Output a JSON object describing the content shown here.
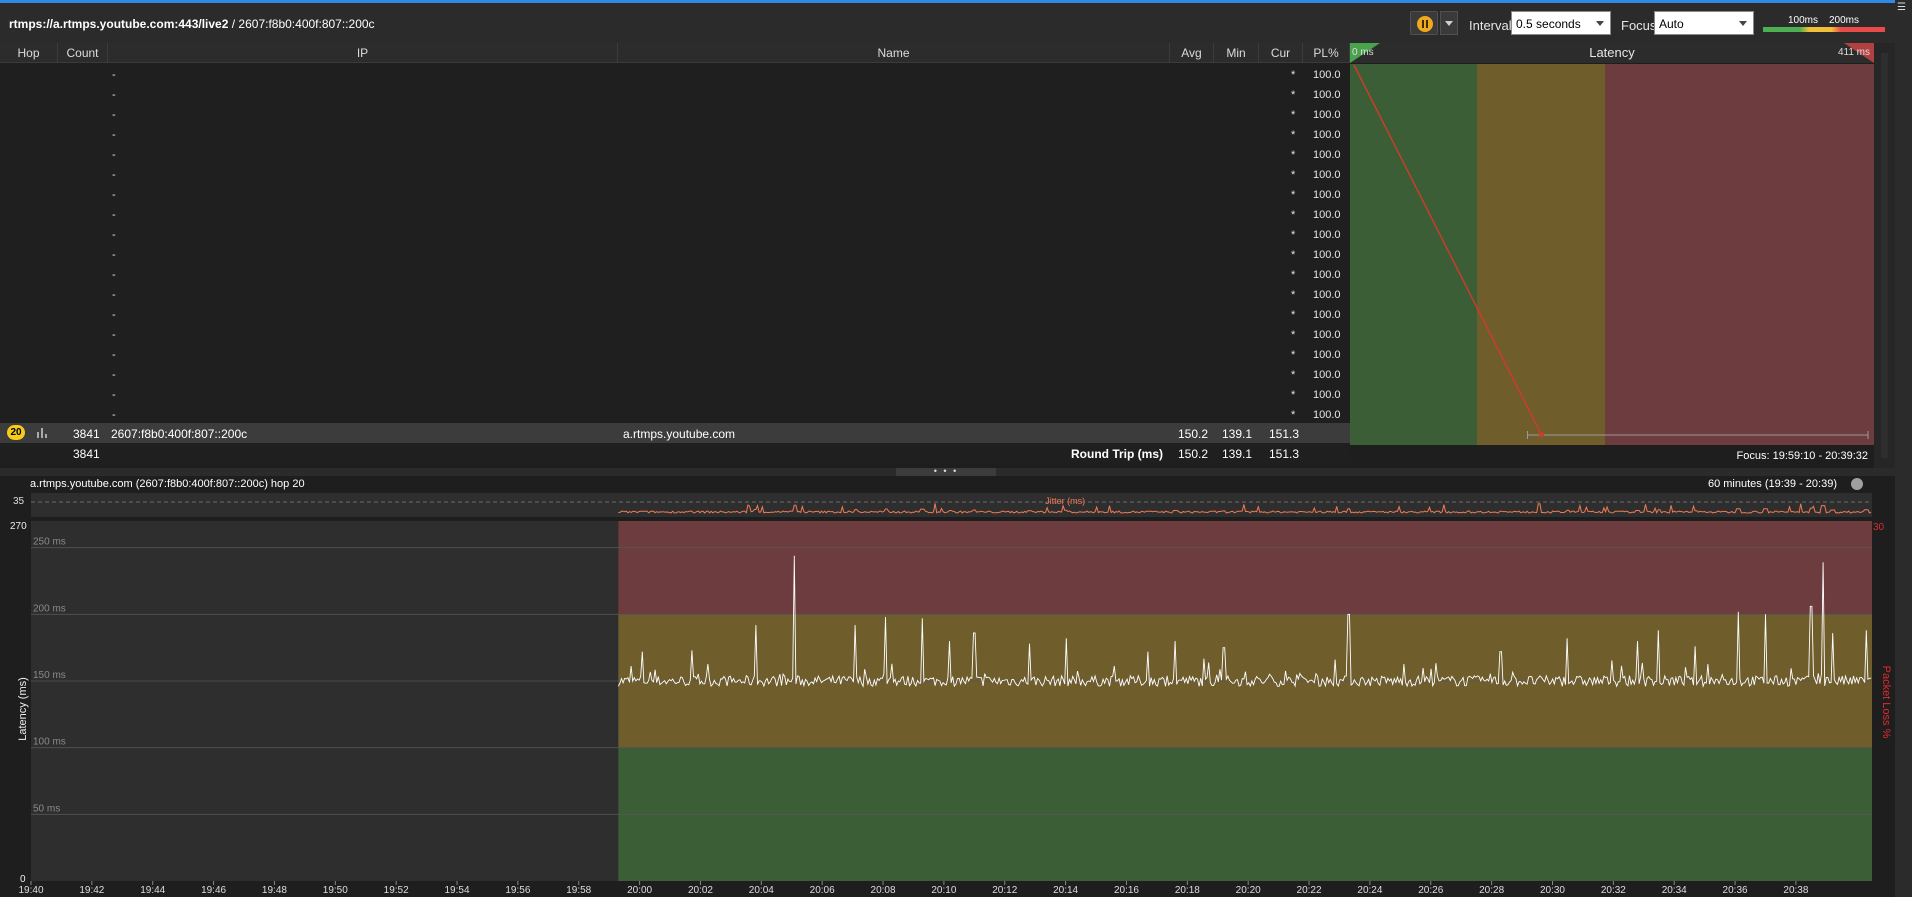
{
  "colors": {
    "accent": "#2f8ae5",
    "good": "#3b5e37",
    "warn": "#6f5d2c",
    "bad": "#6d3c3f",
    "trace": "#ffffff",
    "jitter": "#f07a55"
  },
  "toolbar": {
    "target_host": "rtmps://a.rtmps.youtube.com:443/live2",
    "target_sep": " / ",
    "target_ip": "2607:f8b0:400f:807::200c",
    "pause_icon": "pause-icon",
    "interval_label": "Interval",
    "interval_value": "0.5 seconds",
    "focus_label": "Focus",
    "focus_value": "Auto",
    "scale_low": "100ms",
    "scale_high": "200ms"
  },
  "table": {
    "columns": [
      "Hop",
      "Count",
      "IP",
      "Name",
      "Avg",
      "Min",
      "Cur",
      "PL%"
    ],
    "timeout_rows": [
      {
        "ip": "-",
        "cur": "*",
        "pl": "100.0"
      },
      {
        "ip": "-",
        "cur": "*",
        "pl": "100.0"
      },
      {
        "ip": "-",
        "cur": "*",
        "pl": "100.0"
      },
      {
        "ip": "-",
        "cur": "*",
        "pl": "100.0"
      },
      {
        "ip": "-",
        "cur": "*",
        "pl": "100.0"
      },
      {
        "ip": "-",
        "cur": "*",
        "pl": "100.0"
      },
      {
        "ip": "-",
        "cur": "*",
        "pl": "100.0"
      },
      {
        "ip": "-",
        "cur": "*",
        "pl": "100.0"
      },
      {
        "ip": "-",
        "cur": "*",
        "pl": "100.0"
      },
      {
        "ip": "-",
        "cur": "*",
        "pl": "100.0"
      },
      {
        "ip": "-",
        "cur": "*",
        "pl": "100.0"
      },
      {
        "ip": "-",
        "cur": "*",
        "pl": "100.0"
      },
      {
        "ip": "-",
        "cur": "*",
        "pl": "100.0"
      },
      {
        "ip": "-",
        "cur": "*",
        "pl": "100.0"
      },
      {
        "ip": "-",
        "cur": "*",
        "pl": "100.0"
      },
      {
        "ip": "-",
        "cur": "*",
        "pl": "100.0"
      },
      {
        "ip": "-",
        "cur": "*",
        "pl": "100.0"
      },
      {
        "ip": "-",
        "cur": "*",
        "pl": "100.0"
      }
    ],
    "final_row": {
      "hop": "20",
      "count": "3841",
      "ip": "2607:f8b0:400f:807::200c",
      "name": "a.rtmps.youtube.com",
      "avg": "150.2",
      "min": "139.1",
      "cur": "151.3"
    },
    "summary": {
      "count": "3841",
      "label": "Round Trip (ms)",
      "avg": "150.2",
      "min": "139.1",
      "cur": "151.3"
    }
  },
  "latency_panel": {
    "title": "Latency",
    "min_label": "0 ms",
    "max_label": "411 ms",
    "max_ms": 411,
    "zones_ms": [
      100,
      200
    ],
    "focus_text": "Focus: 19:59:10 - 20:39:32"
  },
  "chart_header": {
    "title": "a.rtmps.youtube.com (2607:f8b0:400f:807::200c) hop 20",
    "range": "60 minutes (19:39 - 20:39)"
  },
  "chart_data": {
    "type": "line",
    "ylabel": "Latency (ms)",
    "y2label": "Packet Loss %",
    "jitter_label": "Jitter (ms)",
    "jitter_max": "35",
    "y_max_label": "270",
    "y_min_label": "0",
    "y2_max_label": "30",
    "ylim": [
      0,
      270
    ],
    "y_ticks": [
      {
        "value": 250,
        "label": "250 ms"
      },
      {
        "value": 200,
        "label": "200 ms"
      },
      {
        "value": 150,
        "label": "150 ms"
      },
      {
        "value": 100,
        "label": "100 ms"
      },
      {
        "value": 50,
        "label": "50 ms"
      }
    ],
    "x_ticks": [
      "19:40",
      "19:42",
      "19:44",
      "19:46",
      "19:48",
      "19:50",
      "19:52",
      "19:54",
      "19:56",
      "19:58",
      "20:00",
      "20:02",
      "20:04",
      "20:06",
      "20:08",
      "20:10",
      "20:12",
      "20:14",
      "20:16",
      "20:18",
      "20:20",
      "20:22",
      "20:24",
      "20:26",
      "20:28",
      "20:30",
      "20:32",
      "20:34",
      "20:36",
      "20:38"
    ],
    "x_start_min": 0,
    "x_end_min": 60.5,
    "data_start_min": 19.3,
    "baseline_ms": 150,
    "spikes": [
      {
        "t": 20.1,
        "ms": 172
      },
      {
        "t": 21.7,
        "ms": 173
      },
      {
        "t": 23.8,
        "ms": 192
      },
      {
        "t": 25.1,
        "ms": 244
      },
      {
        "t": 27.1,
        "ms": 192
      },
      {
        "t": 28.1,
        "ms": 198
      },
      {
        "t": 29.3,
        "ms": 197
      },
      {
        "t": 30.2,
        "ms": 180
      },
      {
        "t": 31.0,
        "ms": 186
      },
      {
        "t": 32.8,
        "ms": 178
      },
      {
        "t": 34.0,
        "ms": 182
      },
      {
        "t": 36.7,
        "ms": 172
      },
      {
        "t": 37.6,
        "ms": 180
      },
      {
        "t": 39.2,
        "ms": 175
      },
      {
        "t": 43.3,
        "ms": 200
      },
      {
        "t": 48.3,
        "ms": 172
      },
      {
        "t": 50.5,
        "ms": 182
      },
      {
        "t": 52.8,
        "ms": 180
      },
      {
        "t": 53.5,
        "ms": 188
      },
      {
        "t": 54.7,
        "ms": 176
      },
      {
        "t": 56.1,
        "ms": 202
      },
      {
        "t": 57.0,
        "ms": 200
      },
      {
        "t": 58.5,
        "ms": 206
      },
      {
        "t": 58.9,
        "ms": 239
      },
      {
        "t": 59.2,
        "ms": 186
      },
      {
        "t": 60.3,
        "ms": 188
      }
    ]
  }
}
